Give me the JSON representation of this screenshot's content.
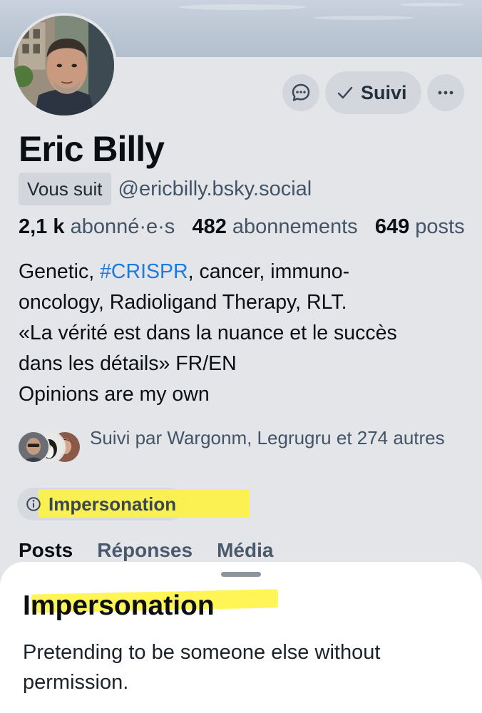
{
  "profile": {
    "display_name": "Eric Billy",
    "follows_you_badge": "Vous suit",
    "handle": "@ericbilly.bsky.social",
    "stats": {
      "followers_count": "2,1 k",
      "followers_label": "abonné·e·s",
      "following_count": "482",
      "following_label": "abonnements",
      "posts_count": "649",
      "posts_label": "posts"
    },
    "bio": {
      "line1_prefix": "Genetic, ",
      "line1_hashtag": "#CRISPR",
      "line1_suffix": ", cancer, immuno-",
      "line2": "oncology, Radioligand Therapy, RLT.",
      "line3": "«La vérité est dans la nuance et le succès",
      "line4": "dans les détails» FR/EN",
      "line5": "Opinions are my own"
    },
    "known_followers": "Suivi par Wargonm, Legrugru et 274 autres",
    "moderation_label": "Impersonation"
  },
  "actions": {
    "follow_state_label": "Suivi",
    "check_icon": "checkmark-icon",
    "message_icon": "chat-bubble-icon",
    "more_icon": "ellipsis-icon"
  },
  "tabs": [
    {
      "label": "Posts",
      "active": true
    },
    {
      "label": "Réponses",
      "active": false
    },
    {
      "label": "Média",
      "active": false
    }
  ],
  "sheet": {
    "title": "Impersonation",
    "description": "Pretending to be someone else without permission."
  },
  "colors": {
    "page_background": "#e4e5e9",
    "hashtag": "#1f7ae0",
    "highlight": "#fff338",
    "muted_text": "#425466"
  }
}
